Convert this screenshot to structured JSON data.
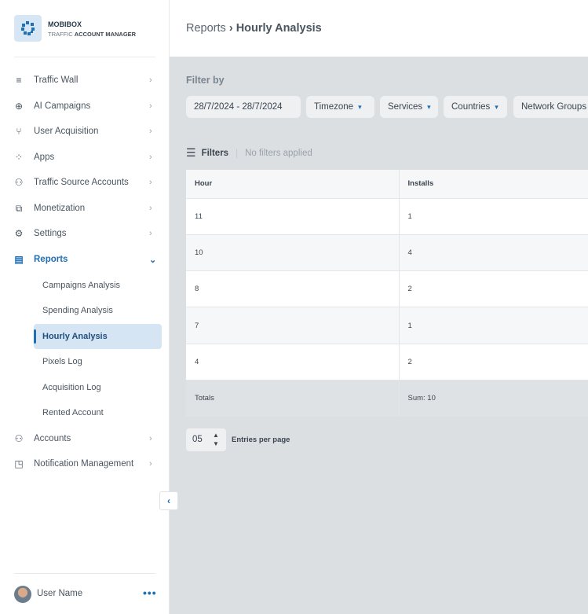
{
  "brand": {
    "name": "MOBIBOX",
    "sub_light": "TRAFFIC",
    "sub_bold": "ACCOUNT MANAGER"
  },
  "nav": [
    {
      "label": "Traffic Wall",
      "icon": "≡"
    },
    {
      "label": "AI Campaigns",
      "icon": "⊕"
    },
    {
      "label": "User Acquisition",
      "icon": "⑂"
    },
    {
      "label": "Apps",
      "icon": "⁘"
    },
    {
      "label": "Traffic Source Accounts",
      "icon": "⚇"
    },
    {
      "label": "Monetization",
      "icon": "⧉"
    },
    {
      "label": "Settings",
      "icon": "⚙"
    },
    {
      "label": "Reports",
      "icon": "▤"
    }
  ],
  "reports_sub": [
    "Campaigns Analysis",
    "Spending Analysis",
    "Hourly Analysis",
    "Pixels Log",
    "Acquisition Log",
    "Rented Account"
  ],
  "nav_bottom": [
    {
      "label": "Accounts",
      "icon": "⚇"
    },
    {
      "label": "Notification Management",
      "icon": "◳"
    }
  ],
  "user": {
    "name": "User Name"
  },
  "breadcrumb": {
    "parent": "Reports",
    "current": "Hourly Analysis"
  },
  "filter_by": "Filter by",
  "chips": {
    "date": "28/7/2024  -  28/7/2024",
    "timezone": "Timezone",
    "services": "Services",
    "countries": "Countries",
    "network_groups": "Network Groups"
  },
  "filters": {
    "label": "Filters",
    "status": "No filters applied"
  },
  "table": {
    "headers": [
      "Hour",
      "Installs"
    ],
    "rows": [
      [
        "11",
        "1"
      ],
      [
        "10",
        "4"
      ],
      [
        "8",
        "2"
      ],
      [
        "7",
        "1"
      ],
      [
        "4",
        "2"
      ]
    ],
    "totals": [
      "Totals",
      "Sum: 10"
    ]
  },
  "pagination": {
    "value": "05",
    "label": "Entries per page"
  }
}
